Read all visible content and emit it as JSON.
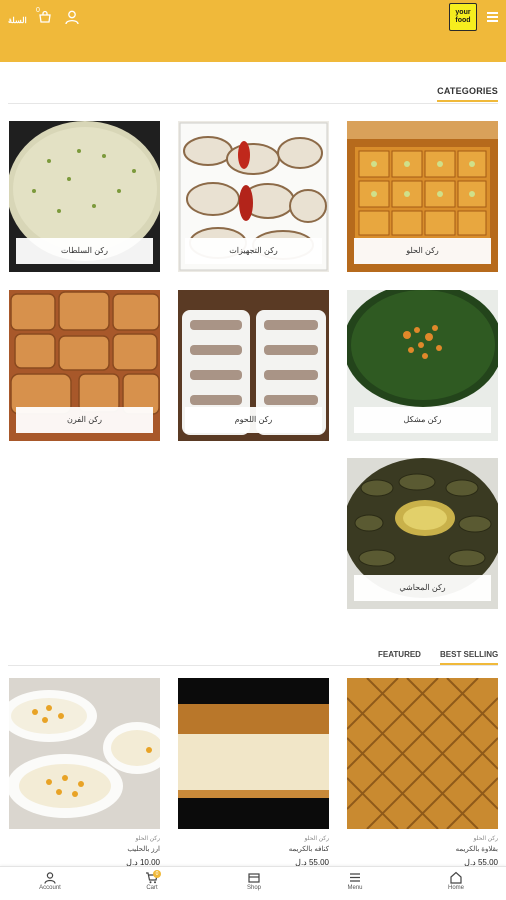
{
  "header": {
    "cart_label": "السلة",
    "cart_count": "0",
    "logo_text": "your food"
  },
  "categories": {
    "title": "CATEGORIES",
    "items": [
      {
        "label": "ركن الحلو"
      },
      {
        "label": "ركن التجهيزات"
      },
      {
        "label": "ركن السلطات"
      },
      {
        "label": "ركن مشكل"
      },
      {
        "label": "ركن اللحوم"
      },
      {
        "label": "ركن الفرن"
      },
      {
        "label": "ركن المحاشي"
      }
    ]
  },
  "products": {
    "tabs": {
      "featured": "FEATURED",
      "best_selling": "BEST SELLING"
    },
    "items": [
      {
        "category": "ركن الحلو",
        "name": "بقلاوة بالكريمه",
        "price": "55.00 د.ل"
      },
      {
        "category": "ركن الحلو",
        "name": "كنافه بالكريمه",
        "price": "55.00 د.ل"
      },
      {
        "category": "ركن الحلو",
        "name": "ارز بالحليب",
        "price": "10.00 د.ل"
      }
    ]
  },
  "bottom_nav": {
    "home": "Home",
    "menu": "Menu",
    "shop": "Shop",
    "cart": "Cart",
    "cart_badge": "0",
    "account": "Account"
  },
  "colors": {
    "brand": "#f0b93a",
    "logo_yellow": "#f6ee1e"
  }
}
